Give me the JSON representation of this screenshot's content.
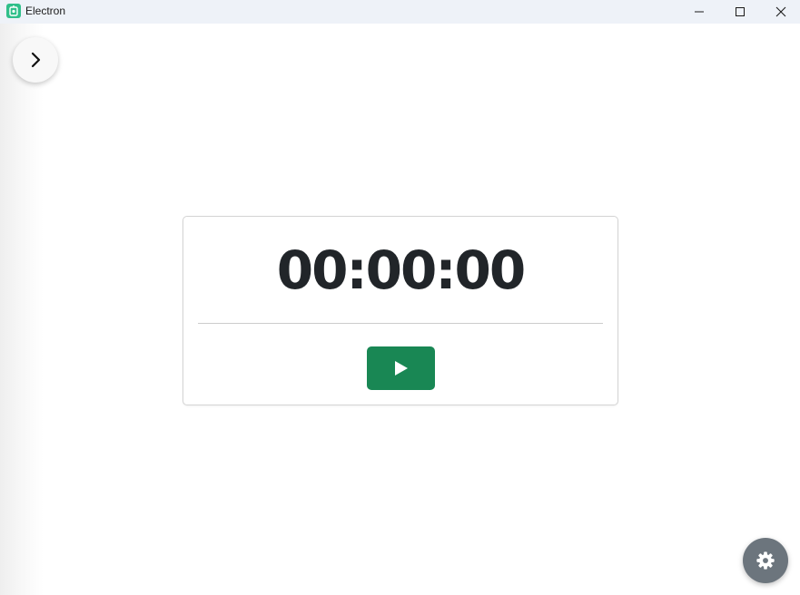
{
  "window": {
    "title": "Electron",
    "controls": [
      "minimize-icon",
      "maximize-icon",
      "close-icon"
    ]
  },
  "sidebar": {
    "toggle_icon": "chevron-right-icon"
  },
  "timer": {
    "display": "00:00:00",
    "play_icon": "play-icon",
    "play_color": "#198754"
  },
  "settings": {
    "icon": "gear-icon",
    "color": "#6c757d"
  },
  "theme": {
    "titlebar_bg": "#eef2f8",
    "text_color": "#212529"
  }
}
